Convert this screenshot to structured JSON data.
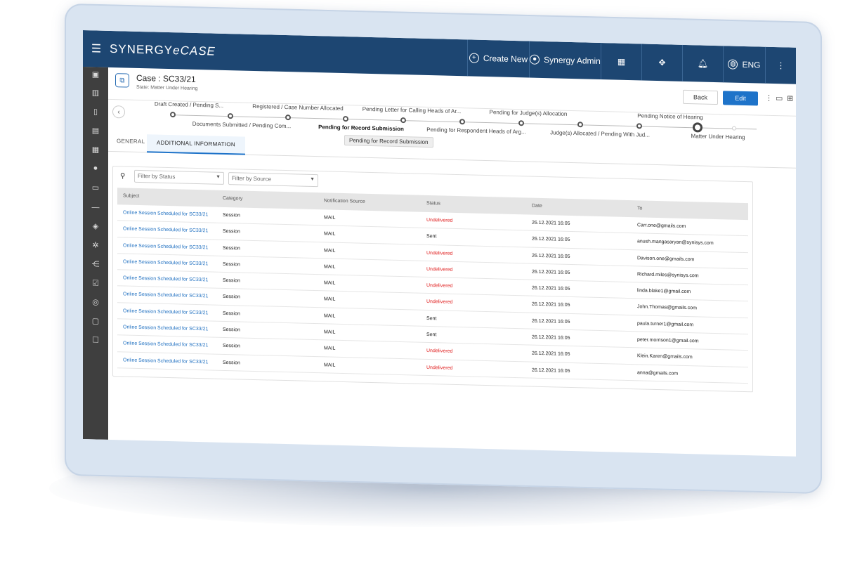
{
  "header": {
    "brand_main": "SYNERGY",
    "brand_sub": "eCASE",
    "create_new": "Create New",
    "user": "Synergy Admin",
    "language": "ENG"
  },
  "case": {
    "title": "Case : SC33/21",
    "state": "State: Matter Under Hearing",
    "back_label": "Back",
    "edit_label": "Edit"
  },
  "workflow": {
    "steps_top": [
      "Draft Created / Pending S...",
      "Registered / Case Number Allocated",
      "Pending Letter for Calling Heads of Ar...",
      "Pending for Judge(s) Allocation",
      "Pending Notice of Hearing"
    ],
    "steps_bottom": [
      "Documents Submitted / Pending Com...",
      "Pending for Record Submission",
      "Pending for Respondent Heads of Arg...",
      "Judge(s) Allocated / Pending With Jud...",
      "Matter Under Hearing"
    ],
    "tooltip": "Pending for Record Submission"
  },
  "tabs": {
    "general": "GENERAL",
    "additional": "ADDITIONAL INFORMATION"
  },
  "filters": {
    "status_placeholder": "Filter by Status",
    "source_placeholder": "Filter by Source"
  },
  "table": {
    "columns": [
      "Subject",
      "Category",
      "Notification Source",
      "Status",
      "Date",
      "To"
    ],
    "rows": [
      [
        "Online Session Scheduled for SC33/21",
        "Session",
        "MAIL",
        "Undelivered",
        "26.12.2021 16:05",
        "Carr.one@gmails.com"
      ],
      [
        "Online Session Scheduled for SC33/21",
        "Session",
        "MAIL",
        "Sent",
        "26.12.2021 16:05",
        "anush.mangasaryan@synisys.com"
      ],
      [
        "Online Session Scheduled for SC33/21",
        "Session",
        "MAIL",
        "Undelivered",
        "26.12.2021 16:05",
        "Davison.one@gmails.com"
      ],
      [
        "Online Session Scheduled for SC33/21",
        "Session",
        "MAIL",
        "Undelivered",
        "26.12.2021 16:05",
        "Richard.miles@synisys.com"
      ],
      [
        "Online Session Scheduled for SC33/21",
        "Session",
        "MAIL",
        "Undelivered",
        "26.12.2021 16:05",
        "linda.blake1@gmail.com"
      ],
      [
        "Online Session Scheduled for SC33/21",
        "Session",
        "MAIL",
        "Undelivered",
        "26.12.2021 16:05",
        "John.Thomas@gmails.com"
      ],
      [
        "Online Session Scheduled for SC33/21",
        "Session",
        "MAIL",
        "Sent",
        "26.12.2021 16:05",
        "paula.turner1@gmail.com"
      ],
      [
        "Online Session Scheduled for SC33/21",
        "Session",
        "MAIL",
        "Sent",
        "26.12.2021 16:05",
        "peter.morrison1@gmail.com"
      ],
      [
        "Online Session Scheduled for SC33/21",
        "Session",
        "MAIL",
        "Undelivered",
        "26.12.2021 16:05",
        "Klein.Karen@gmails.com"
      ],
      [
        "Online Session Scheduled for SC33/21",
        "Session",
        "MAIL",
        "Undelivered",
        "26.12.2021 16:05",
        "anna@gmails.com"
      ]
    ]
  },
  "colors": {
    "header_bg": "#1d4672",
    "sidebar_bg": "#3f3f3f",
    "accent": "#1e73c9",
    "undelivered": "#e02020",
    "link": "#1e6fc0"
  },
  "icons": {
    "sidebar": [
      "dashboard-icon",
      "chart-icon",
      "book-icon",
      "briefcase-icon",
      "calendar-icon",
      "users-icon",
      "document-icon",
      "divider",
      "shield-icon",
      "gear-icon",
      "hierarchy-icon",
      "checklist-icon",
      "database-icon",
      "monitor-icon",
      "task-icon"
    ]
  }
}
